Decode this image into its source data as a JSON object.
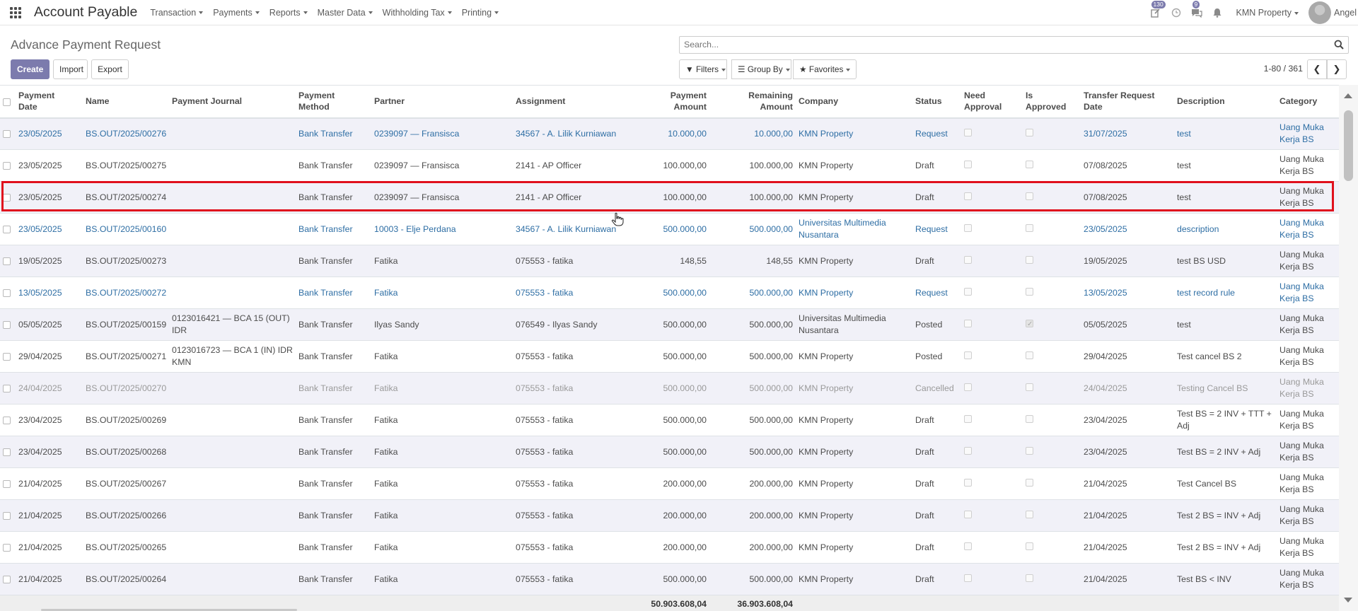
{
  "navbar": {
    "app_title": "Account Payable",
    "menus": [
      "Transaction",
      "Payments",
      "Reports",
      "Master Data",
      "Withholding Tax",
      "Printing"
    ],
    "activity_badge": "130",
    "messages_badge": "9",
    "company": "KMN Property",
    "user": "Angel"
  },
  "control": {
    "page_title": "Advance Payment Request",
    "create_label": "Create",
    "import_label": "Import",
    "export_label": "Export",
    "search_placeholder": "Search...",
    "filters_label": "Filters",
    "groupby_label": "Group By",
    "favorites_label": "Favorites",
    "pager": "1-80 / 361"
  },
  "table": {
    "headers": {
      "payment_date": [
        "Payment",
        "Date"
      ],
      "name": "Name",
      "journal": "Payment Journal",
      "method": [
        "Payment",
        "Method"
      ],
      "partner": "Partner",
      "assignment": "Assignment",
      "amount": [
        "Payment",
        "Amount"
      ],
      "remaining": [
        "Remaining",
        "Amount"
      ],
      "company": "Company",
      "status": "Status",
      "need_approval": [
        "Need",
        "Approval"
      ],
      "is_approved": [
        "Is",
        "Approved"
      ],
      "transfer_date": [
        "Transfer Request",
        "Date"
      ],
      "description": "Description",
      "category": "Category"
    },
    "rows": [
      {
        "date": "23/05/2025",
        "name": "BS.OUT/2025/00276",
        "journal": "",
        "method": "Bank Transfer",
        "partner": "0239097 — Fransisca",
        "assignment": "34567 - A. Lilik Kurniawan",
        "amount": "10.000,00",
        "remaining": "10.000,00",
        "company": "KMN Property",
        "status": "Request",
        "need": false,
        "approved": false,
        "transfer": "31/07/2025",
        "description": "test",
        "category": "Uang Muka Kerja BS",
        "style": "request"
      },
      {
        "date": "23/05/2025",
        "name": "BS.OUT/2025/00275",
        "journal": "",
        "method": "Bank Transfer",
        "partner": "0239097 — Fransisca",
        "assignment": "2141 - AP Officer",
        "amount": "100.000,00",
        "remaining": "100.000,00",
        "company": "KMN Property",
        "status": "Draft",
        "need": false,
        "approved": false,
        "transfer": "07/08/2025",
        "description": "test",
        "category": "Uang Muka Kerja BS",
        "style": "normal"
      },
      {
        "date": "23/05/2025",
        "name": "BS.OUT/2025/00274",
        "journal": "",
        "method": "Bank Transfer",
        "partner": "0239097 — Fransisca",
        "assignment": "2141 - AP Officer",
        "amount": "100.000,00",
        "remaining": "100.000,00",
        "company": "KMN Property",
        "status": "Draft",
        "need": false,
        "approved": false,
        "transfer": "07/08/2025",
        "description": "test",
        "category": "Uang Muka Kerja BS",
        "style": "normal"
      },
      {
        "date": "23/05/2025",
        "name": "BS.OUT/2025/00160",
        "journal": "",
        "method": "Bank Transfer",
        "partner": "10003 - Elje Perdana",
        "assignment": "34567 - A. Lilik Kurniawan",
        "amount": "500.000,00",
        "remaining": "500.000,00",
        "company": "Universitas Multimedia Nusantara",
        "status": "Request",
        "need": false,
        "approved": false,
        "transfer": "23/05/2025",
        "description": "description",
        "category": "Uang Muka Kerja BS",
        "style": "request"
      },
      {
        "date": "19/05/2025",
        "name": "BS.OUT/2025/00273",
        "journal": "",
        "method": "Bank Transfer",
        "partner": "Fatika",
        "assignment": "075553 - fatika",
        "amount": "148,55",
        "remaining": "148,55",
        "company": "KMN Property",
        "status": "Draft",
        "need": false,
        "approved": false,
        "transfer": "19/05/2025",
        "description": "test BS USD",
        "category": "Uang Muka Kerja BS",
        "style": "normal"
      },
      {
        "date": "13/05/2025",
        "name": "BS.OUT/2025/00272",
        "journal": "",
        "method": "Bank Transfer",
        "partner": "Fatika",
        "assignment": "075553 - fatika",
        "amount": "500.000,00",
        "remaining": "500.000,00",
        "company": "KMN Property",
        "status": "Request",
        "need": false,
        "approved": false,
        "transfer": "13/05/2025",
        "description": "test record rule",
        "category": "Uang Muka Kerja BS",
        "style": "request"
      },
      {
        "date": "05/05/2025",
        "name": "BS.OUT/2025/00159",
        "journal": "0123016421 — BCA 15 (OUT) IDR",
        "method": "Bank Transfer",
        "partner": "Ilyas Sandy",
        "assignment": "076549 - Ilyas Sandy",
        "amount": "500.000,00",
        "remaining": "500.000,00",
        "company": "Universitas Multimedia Nusantara",
        "status": "Posted",
        "need": false,
        "approved": true,
        "transfer": "05/05/2025",
        "description": "test",
        "category": "Uang Muka Kerja BS",
        "style": "normal"
      },
      {
        "date": "29/04/2025",
        "name": "BS.OUT/2025/00271",
        "journal": "0123016723 — BCA 1 (IN) IDR KMN",
        "method": "Bank Transfer",
        "partner": "Fatika",
        "assignment": "075553 - fatika",
        "amount": "500.000,00",
        "remaining": "500.000,00",
        "company": "KMN Property",
        "status": "Posted",
        "need": false,
        "approved": false,
        "transfer": "29/04/2025",
        "description": "Test cancel BS 2",
        "category": "Uang Muka Kerja BS",
        "style": "normal"
      },
      {
        "date": "24/04/2025",
        "name": "BS.OUT/2025/00270",
        "journal": "",
        "method": "Bank Transfer",
        "partner": "Fatika",
        "assignment": "075553 - fatika",
        "amount": "500.000,00",
        "remaining": "500.000,00",
        "company": "KMN Property",
        "status": "Cancelled",
        "need": false,
        "approved": false,
        "transfer": "24/04/2025",
        "description": "Testing Cancel BS",
        "category": "Uang Muka Kerja BS",
        "style": "cancelled"
      },
      {
        "date": "23/04/2025",
        "name": "BS.OUT/2025/00269",
        "journal": "",
        "method": "Bank Transfer",
        "partner": "Fatika",
        "assignment": "075553 - fatika",
        "amount": "500.000,00",
        "remaining": "500.000,00",
        "company": "KMN Property",
        "status": "Draft",
        "need": false,
        "approved": false,
        "transfer": "23/04/2025",
        "description": "Test BS = 2 INV + TTT + Adj",
        "category": "Uang Muka Kerja BS",
        "style": "normal"
      },
      {
        "date": "23/04/2025",
        "name": "BS.OUT/2025/00268",
        "journal": "",
        "method": "Bank Transfer",
        "partner": "Fatika",
        "assignment": "075553 - fatika",
        "amount": "500.000,00",
        "remaining": "500.000,00",
        "company": "KMN Property",
        "status": "Draft",
        "need": false,
        "approved": false,
        "transfer": "23/04/2025",
        "description": "Test BS = 2 INV + Adj",
        "category": "Uang Muka Kerja BS",
        "style": "normal"
      },
      {
        "date": "21/04/2025",
        "name": "BS.OUT/2025/00267",
        "journal": "",
        "method": "Bank Transfer",
        "partner": "Fatika",
        "assignment": "075553 - fatika",
        "amount": "200.000,00",
        "remaining": "200.000,00",
        "company": "KMN Property",
        "status": "Draft",
        "need": false,
        "approved": false,
        "transfer": "21/04/2025",
        "description": "Test Cancel BS",
        "category": "Uang Muka Kerja BS",
        "style": "normal"
      },
      {
        "date": "21/04/2025",
        "name": "BS.OUT/2025/00266",
        "journal": "",
        "method": "Bank Transfer",
        "partner": "Fatika",
        "assignment": "075553 - fatika",
        "amount": "200.000,00",
        "remaining": "200.000,00",
        "company": "KMN Property",
        "status": "Draft",
        "need": false,
        "approved": false,
        "transfer": "21/04/2025",
        "description": "Test 2 BS = INV + Adj",
        "category": "Uang Muka Kerja BS",
        "style": "normal"
      },
      {
        "date": "21/04/2025",
        "name": "BS.OUT/2025/00265",
        "journal": "",
        "method": "Bank Transfer",
        "partner": "Fatika",
        "assignment": "075553 - fatika",
        "amount": "200.000,00",
        "remaining": "200.000,00",
        "company": "KMN Property",
        "status": "Draft",
        "need": false,
        "approved": false,
        "transfer": "21/04/2025",
        "description": "Test 2 BS = INV + Adj",
        "category": "Uang Muka Kerja BS",
        "style": "normal"
      },
      {
        "date": "21/04/2025",
        "name": "BS.OUT/2025/00264",
        "journal": "",
        "method": "Bank Transfer",
        "partner": "Fatika",
        "assignment": "075553 - fatika",
        "amount": "500.000,00",
        "remaining": "500.000,00",
        "company": "KMN Property",
        "status": "Draft",
        "need": false,
        "approved": false,
        "transfer": "21/04/2025",
        "description": "Test BS < INV",
        "category": "Uang Muka Kerja BS",
        "style": "normal"
      }
    ],
    "totals": {
      "amount": "50.903.608,04",
      "remaining": "36.903.608,04"
    }
  },
  "colors": {
    "accent": "#7c7bad",
    "link": "#2e6ea4",
    "highlight_border": "#e0101d"
  }
}
